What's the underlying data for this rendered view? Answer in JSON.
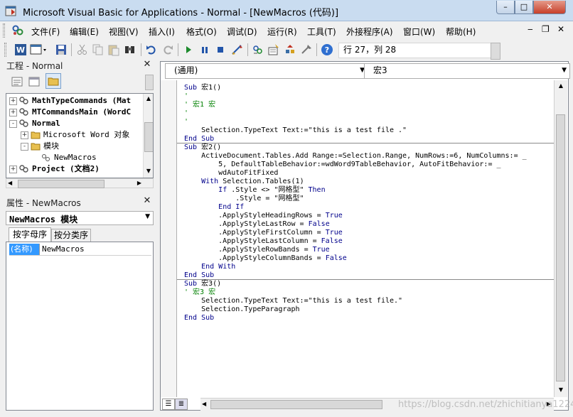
{
  "window": {
    "title": "Microsoft Visual Basic for Applications - Normal - [NewMacros (代码)]",
    "controls": {
      "minimize": "–",
      "maximize": "□",
      "close": "✕"
    }
  },
  "menubar": {
    "items": [
      "文件(F)",
      "编辑(E)",
      "视图(V)",
      "插入(I)",
      "格式(O)",
      "调试(D)",
      "运行(R)",
      "工具(T)",
      "外接程序(A)",
      "窗口(W)",
      "帮助(H)"
    ],
    "mdi_controls": [
      "✕",
      "▭",
      "✕"
    ]
  },
  "toolbar": {
    "cursor_status": "行 27，列 28",
    "icons": [
      "word-icon",
      "insert-userform-icon",
      "save-icon",
      "cut-icon",
      "copy-icon",
      "paste-icon",
      "find-icon",
      "undo-icon",
      "redo-icon",
      "run-icon",
      "break-icon",
      "reset-icon",
      "design-mode-icon",
      "project-explorer-icon",
      "properties-icon",
      "object-browser-icon",
      "toolbox-icon",
      "help-icon"
    ]
  },
  "project_panel": {
    "title": "工程 - Normal",
    "tree": [
      {
        "label": "MathTypeCommands (Mat",
        "level": 0,
        "expander": "+",
        "icon": "project"
      },
      {
        "label": "MTCommandsMain (WordC",
        "level": 0,
        "expander": "+",
        "icon": "project"
      },
      {
        "label": "Normal",
        "level": 0,
        "expander": "-",
        "icon": "project"
      },
      {
        "label": "Microsoft Word 对象",
        "level": 1,
        "expander": "+",
        "icon": "folder"
      },
      {
        "label": "模块",
        "level": 1,
        "expander": "-",
        "icon": "folder"
      },
      {
        "label": "NewMacros",
        "level": 2,
        "expander": "",
        "icon": "module"
      },
      {
        "label": "Project (文档2)",
        "level": 0,
        "expander": "+",
        "icon": "project"
      }
    ]
  },
  "properties_panel": {
    "title": "属性 - NewMacros",
    "object_select": "NewMacros 模块",
    "tabs": [
      "按字母序",
      "按分类序"
    ],
    "rows": [
      {
        "name": "(名称)",
        "value": "NewMacros"
      }
    ]
  },
  "code_window": {
    "object_dropdown": "(通用)",
    "procedure_dropdown": "宏3",
    "lines": [
      [
        [
          "kw",
          "Sub"
        ],
        [
          "n",
          " 宏1()"
        ]
      ],
      [
        [
          "cm",
          "'"
        ]
      ],
      [
        [
          "cm",
          "' 宏1 宏"
        ]
      ],
      [
        [
          "cm",
          "'"
        ]
      ],
      [
        [
          "cm",
          "'"
        ]
      ],
      [
        [
          "n",
          "    Selection.TypeText Text:=\"this is a test file .\""
        ]
      ],
      [
        [
          "kw",
          "End Sub"
        ]
      ],
      [
        [
          "kw",
          "Sub"
        ],
        [
          "n",
          " 宏2()"
        ]
      ],
      [
        [
          "n",
          "    ActiveDocument.Tables.Add Range:=Selection.Range, NumRows:=6, NumColumns:= _"
        ]
      ],
      [
        [
          "n",
          "        5, DefaultTableBehavior:=wdWord9TableBehavior, AutoFitBehavior:= _"
        ]
      ],
      [
        [
          "n",
          "        wdAutoFitFixed"
        ]
      ],
      [
        [
          "n",
          "    "
        ],
        [
          "kw",
          "With"
        ],
        [
          "n",
          " Selection.Tables(1)"
        ]
      ],
      [
        [
          "n",
          "        "
        ],
        [
          "kw",
          "If"
        ],
        [
          "n",
          " .Style <> \"网格型\" "
        ],
        [
          "kw",
          "Then"
        ]
      ],
      [
        [
          "n",
          "            .Style = \"网格型\""
        ]
      ],
      [
        [
          "n",
          "        "
        ],
        [
          "kw",
          "End If"
        ]
      ],
      [
        [
          "n",
          "        .ApplyStyleHeadingRows = "
        ],
        [
          "kw",
          "True"
        ]
      ],
      [
        [
          "n",
          "        .ApplyStyleLastRow = "
        ],
        [
          "kw",
          "False"
        ]
      ],
      [
        [
          "n",
          "        .ApplyStyleFirstColumn = "
        ],
        [
          "kw",
          "True"
        ]
      ],
      [
        [
          "n",
          "        .ApplyStyleLastColumn = "
        ],
        [
          "kw",
          "False"
        ]
      ],
      [
        [
          "n",
          "        .ApplyStyleRowBands = "
        ],
        [
          "kw",
          "True"
        ]
      ],
      [
        [
          "n",
          "        .ApplyStyleColumnBands = "
        ],
        [
          "kw",
          "False"
        ]
      ],
      [
        [
          "n",
          "    "
        ],
        [
          "kw",
          "End With"
        ]
      ],
      [
        [
          "kw",
          "End Sub"
        ]
      ],
      [
        [
          "kw",
          "Sub"
        ],
        [
          "n",
          " 宏3()"
        ]
      ],
      [
        [
          "cm",
          "' 宏3 宏"
        ]
      ],
      [
        [
          "n",
          "    Selection.TypeText Text:=\"this is a test file.\""
        ]
      ],
      [
        [
          "n",
          "    Selection.TypeParagraph"
        ]
      ],
      [
        [
          "kw",
          "End Sub"
        ]
      ]
    ]
  },
  "watermark": "https://blog.csdn.net/zhichitianya1224"
}
